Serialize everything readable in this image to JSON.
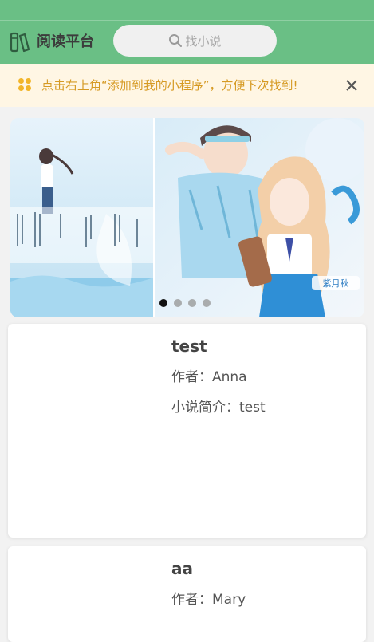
{
  "header": {
    "brand": "阅读平台",
    "search_placeholder": "找小说"
  },
  "tip": {
    "text": "点击右上角“添加到我的小程序”，方便下次找到!",
    "close_label": "×"
  },
  "banner": {
    "slide_count": 4,
    "active_slide": 1,
    "slide2_badge": "紫月秋"
  },
  "books": [
    {
      "title": "test",
      "author_label": "作者：",
      "author": "Anna",
      "intro_label": "小说简介：",
      "intro": "test"
    },
    {
      "title": "aa",
      "author_label": "作者：",
      "author": "Mary"
    }
  ],
  "colors": {
    "header": "#6abf85",
    "tip_bg": "#fff6e4",
    "tip_text": "#d69a23"
  }
}
